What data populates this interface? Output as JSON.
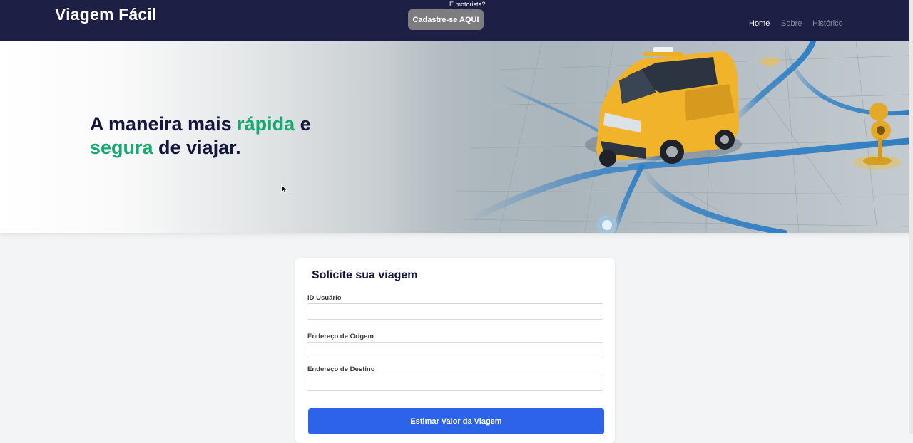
{
  "header": {
    "brand": "Viagem Fácil",
    "driver_question": "É motorista?",
    "driver_button": "Cadastre-se AQUI",
    "nav": [
      {
        "label": "Home",
        "active": true
      },
      {
        "label": "Sobre",
        "active": false
      },
      {
        "label": "Histórico",
        "active": false
      }
    ]
  },
  "hero": {
    "line1_prefix": "A maneira mais ",
    "line1_accent": "rápida",
    "line1_suffix": " e",
    "line2_accent": "segura",
    "line2_suffix": " de viajar.",
    "illustration": "taxi-on-map-illustration"
  },
  "form": {
    "title": "Solicite sua viagem",
    "fields": [
      {
        "label": "ID Usuário",
        "value": "",
        "placeholder": ""
      },
      {
        "label": "Endereço de Origem",
        "value": "",
        "placeholder": ""
      },
      {
        "label": "Endereço de Destino",
        "value": "",
        "placeholder": ""
      }
    ],
    "submit": "Estimar Valor da Viagem"
  },
  "colors": {
    "header_bg": "#1d1f45",
    "accent_green": "#19a874",
    "primary_blue": "#2c63e8",
    "title_navy": "#14163d",
    "taxi_yellow": "#f0b32a"
  }
}
